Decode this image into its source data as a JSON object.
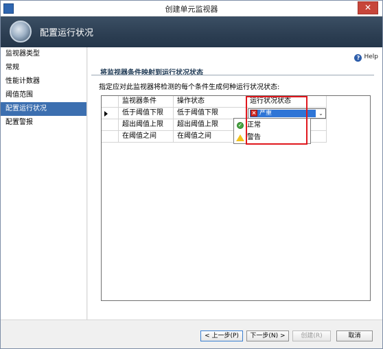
{
  "window": {
    "title": "创建单元监视器"
  },
  "banner": {
    "heading": "配置运行状况"
  },
  "nav": {
    "items": [
      {
        "label": "监视器类型"
      },
      {
        "label": "常规"
      },
      {
        "label": "性能计数器"
      },
      {
        "label": "阈值范围"
      },
      {
        "label": "配置运行状况"
      },
      {
        "label": "配置警报"
      }
    ],
    "selected": "配置运行状况"
  },
  "content": {
    "help_label": "Help",
    "section_title": "将监视器条件映射到运行状况状态",
    "description": "指定应对此监视器将检测的每个条件生成何种运行状况状态:"
  },
  "grid": {
    "headers": [
      "监视器条件",
      "操作状态",
      "运行状况状态"
    ],
    "rows": [
      {
        "condition": "低于阈值下限",
        "op_state": "低于阈值下限",
        "health": "严重"
      },
      {
        "condition": "超出阈值上限",
        "op_state": "超出阈值上限",
        "health": ""
      },
      {
        "condition": "在阈值之间",
        "op_state": "在阈值之间",
        "health": ""
      }
    ],
    "dropdown_options": [
      {
        "label": "严重",
        "icon": "error-icon"
      },
      {
        "label": "正常",
        "icon": "ok-icon"
      },
      {
        "label": "警告",
        "icon": "warning-icon"
      }
    ]
  },
  "footer": {
    "back": "< 上一步(P)",
    "next": "下一步(N) >",
    "create": "创建(R)",
    "cancel": "取消"
  },
  "colors": {
    "nav_selected": "#3c6fb0",
    "highlight_box": "#e0161c",
    "dropdown_selected": "#2e75d6"
  }
}
